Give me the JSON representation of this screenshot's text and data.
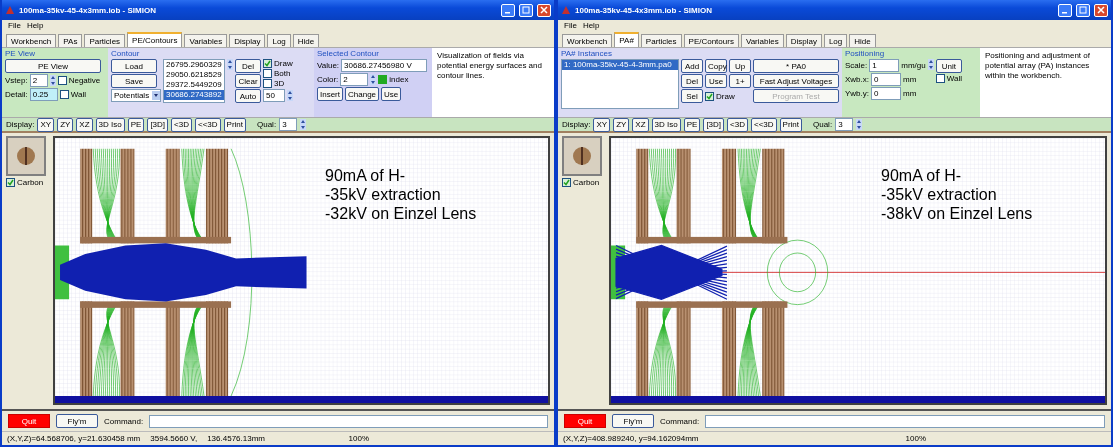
{
  "windows": [
    {
      "title": "100ma-35kv-45-4x3mm.iob - SIMION",
      "menu": [
        "File",
        "Help"
      ],
      "tabs": [
        {
          "label": "Workbench",
          "selected": false
        },
        {
          "label": "PAs",
          "selected": false
        },
        {
          "label": "Particles",
          "selected": false
        },
        {
          "label": "PE/Contours",
          "selected": true
        },
        {
          "label": "Variables",
          "selected": false
        },
        {
          "label": "Display",
          "selected": false
        },
        {
          "label": "Log",
          "selected": false
        },
        {
          "label": "Hide",
          "selected": false
        }
      ],
      "panel": {
        "kind": "contours",
        "pe_view": {
          "title": "PE View",
          "button": "PE View",
          "vstep_label": "Vstep:",
          "vstep": "2",
          "negative": {
            "label": "Negative",
            "checked": false
          },
          "detail_label": "Detail:",
          "detail": "0.25",
          "wall": {
            "label": "Wall",
            "checked": false
          }
        },
        "contour": {
          "title": "Contour",
          "load": "Load",
          "save": "Save",
          "type": "Potentials",
          "values": [
            {
              "text": "26795.2960329",
              "selected": false
            },
            {
              "text": "29050.6218529",
              "selected": false
            },
            {
              "text": "29372.5449209",
              "selected": false
            },
            {
              "text": "30686.2743892",
              "selected": true
            }
          ],
          "del": "Del",
          "clear": "Clear",
          "auto": "Auto",
          "checks": [
            {
              "label": "Draw",
              "checked": true
            },
            {
              "label": "Both",
              "checked": false
            },
            {
              "label": "3D",
              "checked": false
            }
          ],
          "count": "50"
        },
        "selected_contour": {
          "title": "Selected Contour",
          "value_label": "Value:",
          "value": "30686.27456980 V",
          "color_label": "Color:",
          "color_index": "2",
          "index_label": "index",
          "buttons": [
            "Insert",
            "Change",
            "Use"
          ]
        }
      },
      "description": "Visualization of fields via potential energy surfaces and contour lines.",
      "display": {
        "label": "Display:",
        "buttons": [
          "XY",
          "ZY",
          "XZ",
          "3D Iso",
          "PE",
          "[3D]",
          "<3D",
          "<<3D",
          "Print"
        ],
        "quality_label": "Qual:",
        "quality": "3"
      },
      "canvas": {
        "thumbnail_label": "Carbon",
        "thumbnail_checked": true,
        "annotation": [
          "90mA of H-",
          "-35kV extraction",
          "-32kV on Einzel Lens"
        ],
        "kind": "diverging"
      },
      "command": {
        "quit": "Quit",
        "fly": "Fly'm",
        "label": "Command:"
      },
      "status": {
        "items": [
          "(X,Y,Z)=64.568706, y=21.630458 mm",
          "3594.5660 V,",
          "136.4576.13mm"
        ],
        "zoom": "100%"
      }
    },
    {
      "title": "100ma-35kv-45-4x3mm.iob - SIMION",
      "menu": [
        "File",
        "Help"
      ],
      "tabs": [
        {
          "label": "Workbench",
          "selected": false
        },
        {
          "label": "PA#",
          "selected": true
        },
        {
          "label": "Particles",
          "selected": false
        },
        {
          "label": "PE/Contours",
          "selected": false
        },
        {
          "label": "Variables",
          "selected": false
        },
        {
          "label": "Display",
          "selected": false
        },
        {
          "label": "Log",
          "selected": false
        },
        {
          "label": "Hide",
          "selected": false
        }
      ],
      "panel": {
        "kind": "instances",
        "instances": {
          "title": "PA# Instances",
          "items": [
            {
              "text": "1: 100ma-35kv-45-4-3mm.pa0",
              "selected": true
            }
          ],
          "buttons": [
            "Add",
            "Copy",
            "Up",
            "Del",
            "Use",
            "1+",
            "Sel"
          ],
          "draw": {
            "label": "Draw",
            "checked": true
          },
          "pa_button": "* PA0",
          "fast_adjust": "Fast Adjust Voltages",
          "program_test": {
            "label": "Program Test",
            "disabled": true
          }
        },
        "positioning": {
          "title": "Positioning",
          "rows": [
            {
              "label": "Scale:",
              "value": "1",
              "unit": "mm/gu"
            },
            {
              "label": "Xwb.x:",
              "value": "0",
              "unit": "mm"
            },
            {
              "label": "Ywb.y:",
              "value": "0",
              "unit": "mm"
            }
          ],
          "unit_button": "Unit",
          "wall": {
            "label": "Wall",
            "checked": false
          }
        }
      },
      "description": "Positioning and adjustment of potential array (PA) instances within the workbench.",
      "display": {
        "label": "Display:",
        "buttons": [
          "XY",
          "ZY",
          "XZ",
          "3D Iso",
          "PE",
          "[3D]",
          "<3D",
          "<<3D",
          "Print"
        ],
        "quality_label": "Qual:",
        "quality": "3"
      },
      "canvas": {
        "thumbnail_label": "Carbon",
        "thumbnail_checked": true,
        "annotation": [
          "90mA of H-",
          "-35kV extraction",
          "-38kV on Einzel Lens"
        ],
        "kind": "converging"
      },
      "command": {
        "quit": "Quit",
        "fly": "Fly'm",
        "label": "Command:"
      },
      "status": {
        "items": [
          "(X,Y,Z)=408.989240, y=94.162094mm"
        ],
        "zoom": "100%"
      }
    }
  ]
}
